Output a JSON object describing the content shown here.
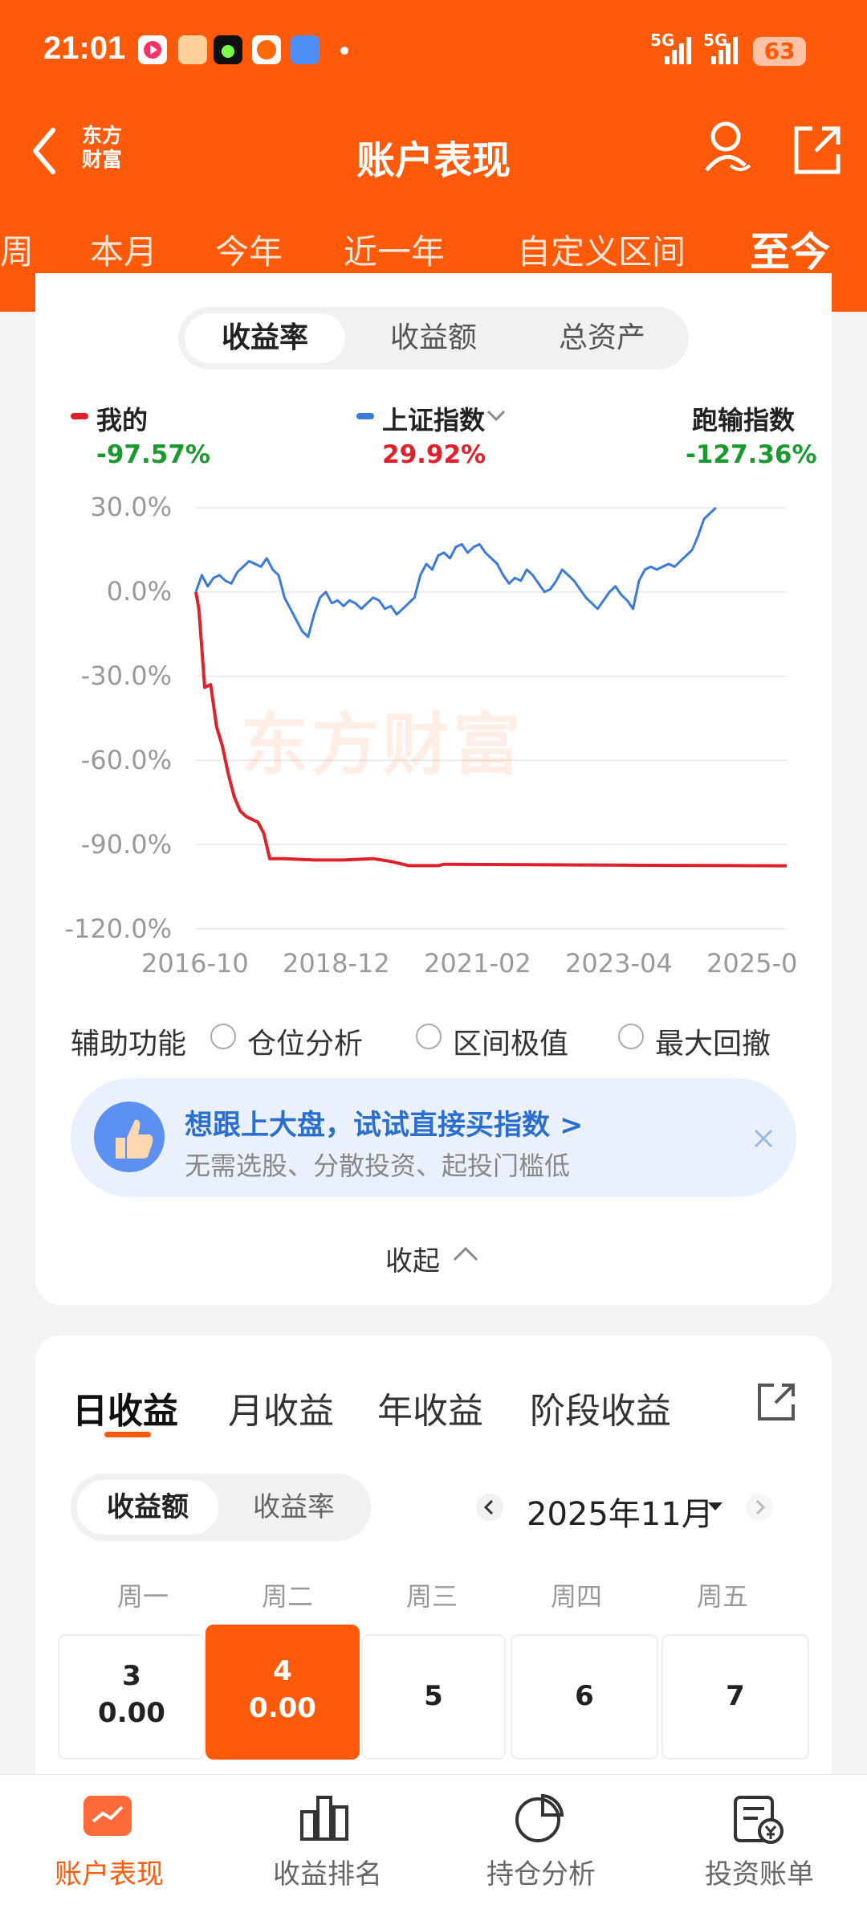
{
  "status": {
    "time": "21:01",
    "signal1": "5G",
    "signal2": "5G",
    "battery": "63"
  },
  "header": {
    "logo_text_line1": "东方",
    "logo_text_line2": "财富",
    "title": "账户表现"
  },
  "period_tabs": [
    "周",
    "本月",
    "今年",
    "近一年",
    "自定义区间",
    "至今"
  ],
  "metric_tabs": [
    "收益率",
    "收益额",
    "总资产"
  ],
  "legend": [
    {
      "name": "我的",
      "value": "-97.57%",
      "color": "#e0202a"
    },
    {
      "name": "上证指数",
      "value": "29.92%",
      "color": "#3b7ad8"
    },
    {
      "name": "跑输指数",
      "value": "-127.36%"
    }
  ],
  "watermark": "东方财富",
  "chart_data": {
    "type": "line",
    "y_ticks": [
      "30.0%",
      "0.0%",
      "-30.0%",
      "-60.0%",
      "-90.0%",
      "-120.0%"
    ],
    "x_ticks": [
      "2016-10",
      "2018-12",
      "2021-02",
      "2023-04",
      "2025-0"
    ],
    "ylim": [
      -120,
      30
    ],
    "grid": true,
    "series": [
      {
        "name": "我的",
        "color": "#e0202a",
        "points": [
          [
            0,
            0
          ],
          [
            0.5,
            -6
          ],
          [
            1.0,
            -20
          ],
          [
            1.5,
            -34
          ],
          [
            2.5,
            -33
          ],
          [
            3.5,
            -48
          ],
          [
            4.5,
            -55
          ],
          [
            5.5,
            -65
          ],
          [
            6.5,
            -73
          ],
          [
            7.5,
            -78
          ],
          [
            8.5,
            -80
          ],
          [
            9.5,
            -81
          ],
          [
            10.5,
            -82
          ],
          [
            11.5,
            -86
          ],
          [
            12.5,
            -95
          ],
          [
            15,
            -95
          ],
          [
            20,
            -95.5
          ],
          [
            25,
            -95.5
          ],
          [
            30,
            -95
          ],
          [
            33,
            -96
          ],
          [
            36,
            -97.5
          ],
          [
            41,
            -97.5
          ],
          [
            42,
            -97
          ],
          [
            60,
            -97.2
          ],
          [
            80,
            -97.4
          ],
          [
            100,
            -97.57
          ]
        ]
      },
      {
        "name": "上证指数",
        "color": "#3b7ad8",
        "points": [
          [
            0,
            0
          ],
          [
            1,
            6
          ],
          [
            2,
            2
          ],
          [
            3,
            5
          ],
          [
            4,
            6
          ],
          [
            5,
            4
          ],
          [
            6,
            3
          ],
          [
            7,
            7
          ],
          [
            8,
            9
          ],
          [
            9,
            11
          ],
          [
            10,
            10
          ],
          [
            11,
            9
          ],
          [
            12,
            12
          ],
          [
            13,
            8
          ],
          [
            14,
            6
          ],
          [
            15,
            -2
          ],
          [
            16,
            -6
          ],
          [
            17,
            -10
          ],
          [
            18,
            -14
          ],
          [
            19,
            -16
          ],
          [
            20,
            -8
          ],
          [
            21,
            -2
          ],
          [
            22,
            0
          ],
          [
            23,
            -4
          ],
          [
            24,
            -3
          ],
          [
            25,
            -5
          ],
          [
            26,
            -3
          ],
          [
            27,
            -4
          ],
          [
            28,
            -6
          ],
          [
            29,
            -4
          ],
          [
            30,
            -2
          ],
          [
            31,
            -3
          ],
          [
            32,
            -6
          ],
          [
            33,
            -5
          ],
          [
            34,
            -8
          ],
          [
            35,
            -6
          ],
          [
            36,
            -4
          ],
          [
            37,
            -2
          ],
          [
            38,
            6
          ],
          [
            39,
            10
          ],
          [
            40,
            8
          ],
          [
            41,
            13
          ],
          [
            42,
            14
          ],
          [
            43,
            12
          ],
          [
            44,
            16
          ],
          [
            45,
            17
          ],
          [
            46,
            14
          ],
          [
            47,
            16
          ],
          [
            48,
            17
          ],
          [
            49,
            14
          ],
          [
            50,
            12
          ],
          [
            51,
            10
          ],
          [
            52,
            6
          ],
          [
            53,
            3
          ],
          [
            54,
            5
          ],
          [
            55,
            4
          ],
          [
            56,
            8
          ],
          [
            57,
            6
          ],
          [
            58,
            3
          ],
          [
            59,
            0
          ],
          [
            60,
            1
          ],
          [
            61,
            4
          ],
          [
            62,
            8
          ],
          [
            63,
            6
          ],
          [
            64,
            4
          ],
          [
            65,
            1
          ],
          [
            66,
            -2
          ],
          [
            67,
            -4
          ],
          [
            68,
            -6
          ],
          [
            69,
            -3
          ],
          [
            70,
            0
          ],
          [
            71,
            2
          ],
          [
            72,
            -1
          ],
          [
            73,
            -3
          ],
          [
            74,
            -6
          ],
          [
            75,
            4
          ],
          [
            76,
            8
          ],
          [
            77,
            9
          ],
          [
            78,
            8
          ],
          [
            79,
            9
          ],
          [
            80,
            10
          ],
          [
            81,
            9
          ],
          [
            82,
            11
          ],
          [
            83,
            13
          ],
          [
            84,
            15
          ],
          [
            85,
            20
          ],
          [
            86,
            26
          ],
          [
            87,
            28
          ],
          [
            88,
            30
          ]
        ]
      }
    ]
  },
  "aux": {
    "label": "辅助功能",
    "options": [
      "仓位分析",
      "区间极值",
      "最大回撤"
    ]
  },
  "banner": {
    "title": "想跟上大盘，试试直接买指数 >",
    "subtitle": "无需选股、分散投资、起投门槛低"
  },
  "collapse_label": "收起",
  "profit": {
    "tabs": [
      "日收益",
      "月收益",
      "年收益",
      "阶段收益"
    ],
    "toggle": [
      "收益额",
      "收益率"
    ],
    "month": "2025年11月",
    "weekdays": [
      "周一",
      "周二",
      "周三",
      "周四",
      "周五"
    ],
    "days": [
      {
        "day": "3",
        "value": "0.00"
      },
      {
        "day": "4",
        "value": "0.00"
      },
      {
        "day": "5",
        "value": ""
      },
      {
        "day": "6",
        "value": ""
      },
      {
        "day": "7",
        "value": ""
      }
    ]
  },
  "bottom_nav": [
    "账户表现",
    "收益排名",
    "持仓分析",
    "投资账单"
  ]
}
